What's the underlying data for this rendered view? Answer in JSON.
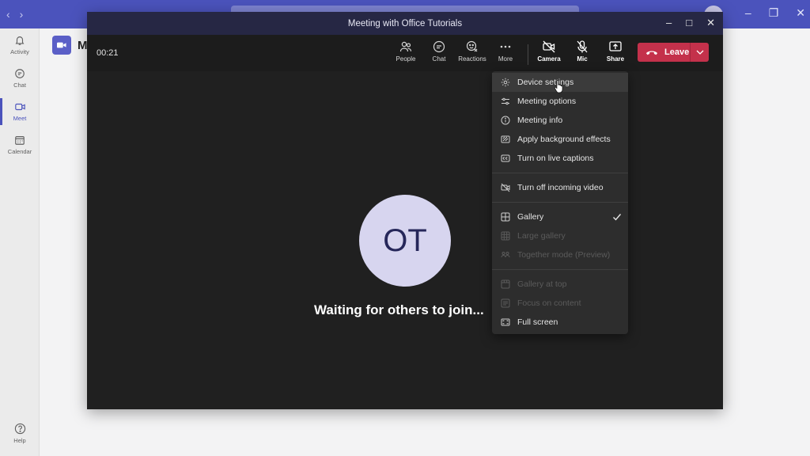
{
  "app": {
    "title_initial": "M",
    "rail": [
      {
        "label": "Activity",
        "icon": "bell-icon"
      },
      {
        "label": "Chat",
        "icon": "chat-icon"
      },
      {
        "label": "Meet",
        "icon": "video-icon",
        "active": true
      },
      {
        "label": "Calendar",
        "icon": "calendar-icon"
      }
    ],
    "help_label": "Help"
  },
  "meeting": {
    "window_title": "Meeting with Office Tutorials",
    "timer": "00:21",
    "toolbar": {
      "people": "People",
      "chat": "Chat",
      "reactions": "Reactions",
      "more": "More",
      "camera": "Camera",
      "mic": "Mic",
      "share": "Share",
      "leave": "Leave"
    },
    "participant_initials": "OT",
    "waiting_text": "Waiting for others to join..."
  },
  "more_menu": {
    "items": [
      {
        "label": "Device settings",
        "icon": "gear-icon"
      },
      {
        "label": "Meeting options",
        "icon": "sliders-icon"
      },
      {
        "label": "Meeting info",
        "icon": "info-icon"
      },
      {
        "label": "Apply background effects",
        "icon": "background-effects-icon"
      },
      {
        "label": "Turn on live captions",
        "icon": "captions-icon"
      },
      {
        "label": "Turn off incoming video",
        "icon": "video-off-icon"
      },
      {
        "label": "Gallery",
        "icon": "gallery-icon",
        "checked": true
      },
      {
        "label": "Large gallery",
        "icon": "large-gallery-icon",
        "disabled": true
      },
      {
        "label": "Together mode (Preview)",
        "icon": "together-mode-icon",
        "disabled": true
      },
      {
        "label": "Gallery at top",
        "icon": "gallery-top-icon",
        "disabled": true
      },
      {
        "label": "Focus on content",
        "icon": "focus-icon",
        "disabled": true
      },
      {
        "label": "Full screen",
        "icon": "fullscreen-icon"
      }
    ]
  },
  "colors": {
    "brand": "#4b53bc",
    "leave": "#c4314b",
    "stage": "#202020",
    "menu": "#2d2d2d"
  }
}
